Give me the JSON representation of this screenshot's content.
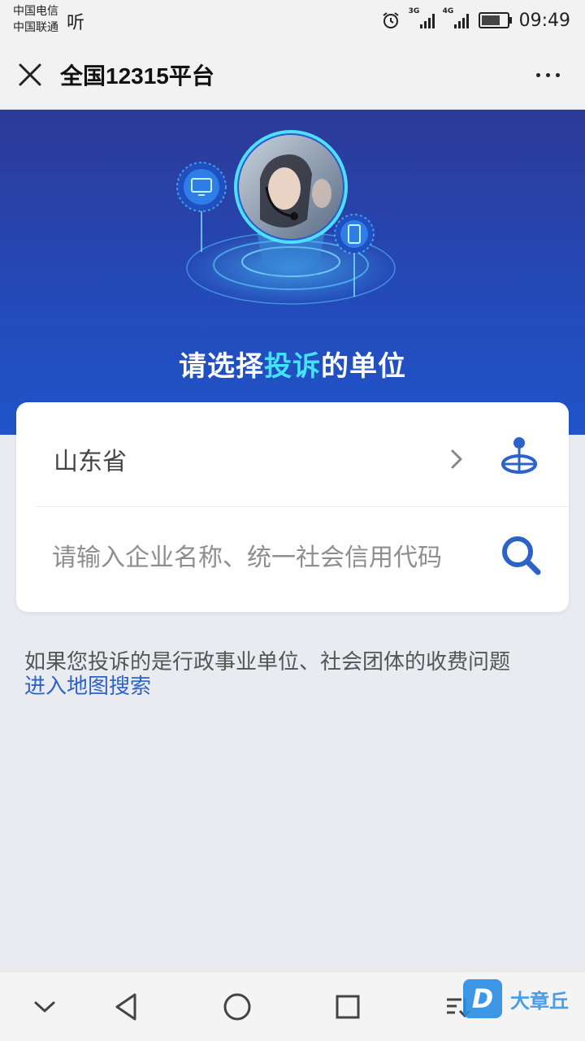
{
  "status_bar": {
    "carrier_1": "中国电信",
    "carrier_2": "中国联通",
    "listen_label": "听",
    "network_1": "3G",
    "network_2": "4G",
    "time": "09:49",
    "battery_level": 0.85,
    "icons": [
      "alarm-icon",
      "signal-icon",
      "battery-icon"
    ]
  },
  "titlebar": {
    "title": "全国12315平台",
    "icons": [
      "close-icon",
      "more-icon"
    ]
  },
  "hero": {
    "heading_part1": "请选择",
    "heading_highlight": "投诉",
    "heading_part2": "的单位",
    "highlight_color": "#43e3ff",
    "icons": [
      "customer-service-avatar",
      "monitor-icon",
      "phone-icon"
    ]
  },
  "card": {
    "province": "山东省",
    "search_placeholder": "请输入企业名称、统一社会信用代码",
    "icons": [
      "chevron-right-icon",
      "locate-icon",
      "search-icon"
    ]
  },
  "hint": {
    "text": "如果您投诉的是行政事业单位、社会团体的收费问题",
    "link": "进入地图搜索"
  },
  "watermark": {
    "logo_letter": "D",
    "text": "大章丘"
  },
  "nav": {
    "icons": [
      "collapse-icon",
      "back-icon",
      "home-icon",
      "recents-icon",
      "download-icon"
    ]
  },
  "colors": {
    "accent": "#2c63c8",
    "hero_top": "#2c3a98",
    "hero_bottom": "#1f55c8"
  }
}
